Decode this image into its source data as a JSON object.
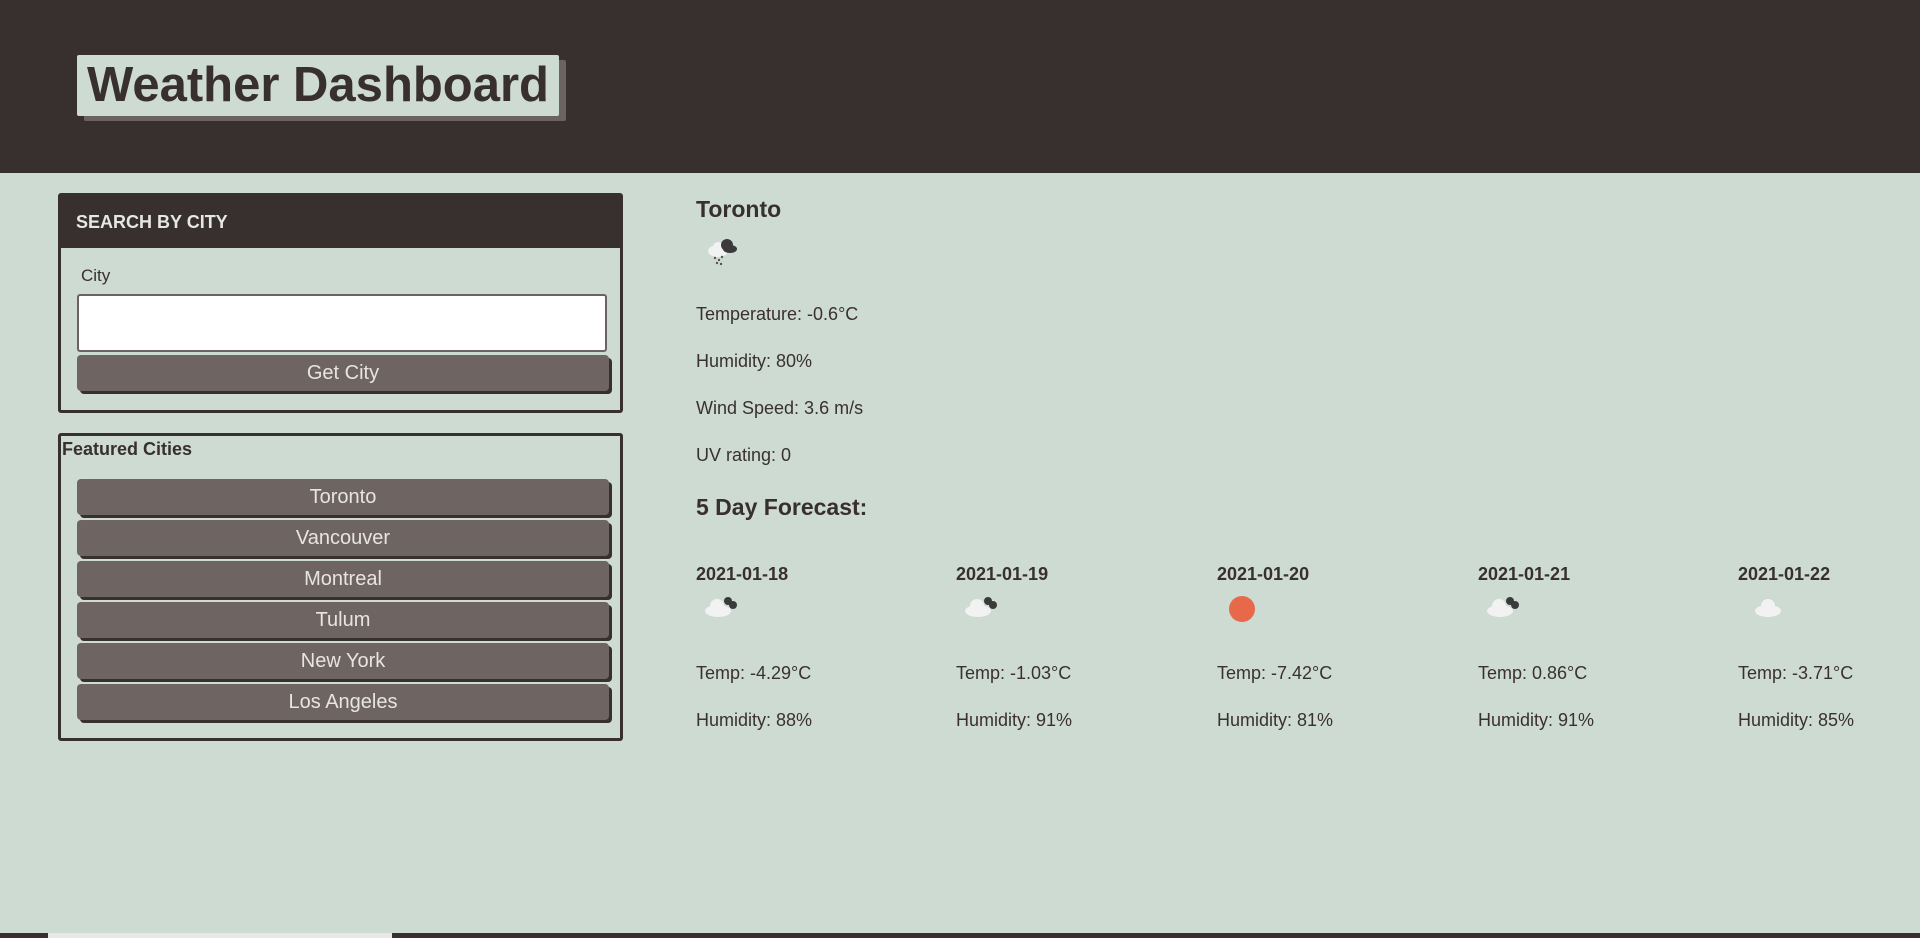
{
  "header": {
    "title": "Weather Dashboard"
  },
  "search": {
    "heading": "SEARCH BY CITY",
    "label": "City",
    "input_value": "",
    "placeholder": "",
    "button_label": "Get City"
  },
  "featured": {
    "heading": "Featured Cities",
    "cities": [
      "Toronto",
      "Vancouver",
      "Montreal",
      "Tulum",
      "New York",
      "Los Angeles"
    ]
  },
  "current": {
    "city": "Toronto",
    "icon": "snow-cloud-icon",
    "temperature": "Temperature: -0.6°C",
    "humidity": "Humidity: 80%",
    "wind": "Wind Speed: 3.6 m/s",
    "uv": "UV rating: 0"
  },
  "forecast": {
    "heading": "5 Day Forecast:",
    "days": [
      {
        "date": "2021-01-18",
        "icon": "cloudy-icon",
        "temp": "Temp: -4.29°C",
        "humidity": "Humidity: 88%"
      },
      {
        "date": "2021-01-19",
        "icon": "cloudy-icon",
        "temp": "Temp: -1.03°C",
        "humidity": "Humidity: 91%"
      },
      {
        "date": "2021-01-20",
        "icon": "sun-icon",
        "temp": "Temp: -7.42°C",
        "humidity": "Humidity: 81%"
      },
      {
        "date": "2021-01-21",
        "icon": "cloudy-icon",
        "temp": "Temp: 0.86°C",
        "humidity": "Humidity: 91%"
      },
      {
        "date": "2021-01-22",
        "icon": "cloud-icon",
        "temp": "Temp: -3.71°C",
        "humidity": "Humidity: 85%"
      }
    ]
  },
  "colors": {
    "background": "#cddbd2",
    "dark": "#382f2f",
    "button": "#6e6563",
    "sun": "#e8694a"
  }
}
